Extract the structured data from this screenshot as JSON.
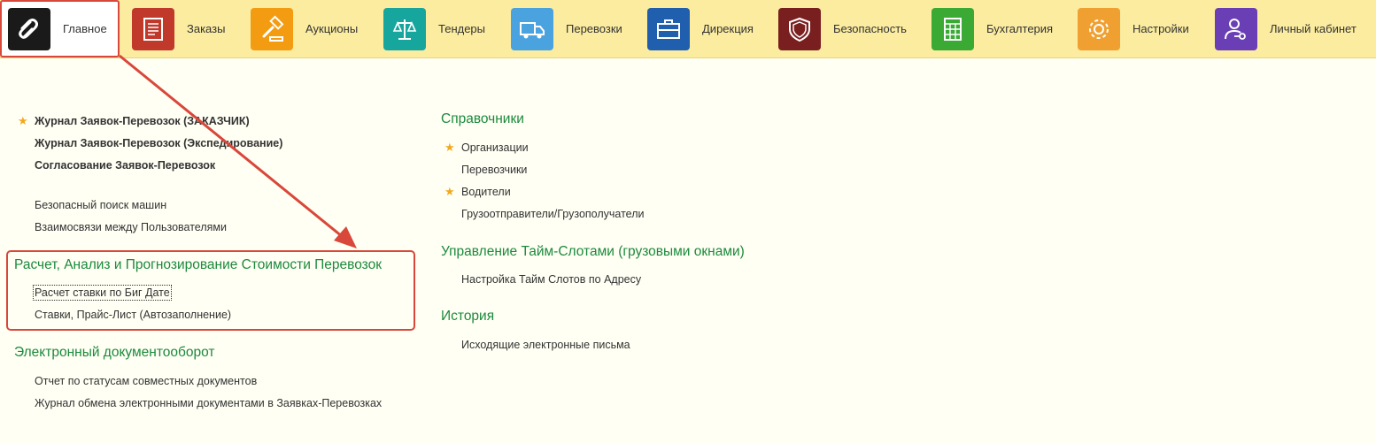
{
  "colors": {
    "accent_red": "#d9473a",
    "link_green": "#1b8a3c",
    "topbar": "#fbeca0",
    "background": "#fffff4",
    "star": "#f2a91f"
  },
  "nav": [
    {
      "id": "main",
      "label": "Главное",
      "icon": "logo-icon",
      "color": "#1a1a1a",
      "active": true
    },
    {
      "id": "orders",
      "label": "Заказы",
      "icon": "notebook-icon",
      "color": "#c0392b"
    },
    {
      "id": "auctions",
      "label": "Аукционы",
      "icon": "gavel-icon",
      "color": "#f39c12"
    },
    {
      "id": "tenders",
      "label": "Тендеры",
      "icon": "scales-icon",
      "color": "#16a69e"
    },
    {
      "id": "transport",
      "label": "Перевозки",
      "icon": "truck-icon",
      "color": "#4aa3df"
    },
    {
      "id": "direction",
      "label": "Дирекция",
      "icon": "briefcase-icon",
      "color": "#1f5fae"
    },
    {
      "id": "security",
      "label": "Безопасность",
      "icon": "shield-icon",
      "color": "#7a1f1f"
    },
    {
      "id": "accounting",
      "label": "Бухгалтерия",
      "icon": "calculator-icon",
      "color": "#3aaa35"
    },
    {
      "id": "settings",
      "label": "Настройки",
      "icon": "gear-icon",
      "color": "#f0a030"
    },
    {
      "id": "cabinet",
      "label": "Личный кабинет",
      "icon": "user-key-icon",
      "color": "#6a3fb5"
    }
  ],
  "left": {
    "top_links": [
      {
        "label": "Журнал Заявок-Перевозок (ЗАКАЗЧИК)",
        "starred": true
      },
      {
        "label": "Журнал Заявок-Перевозок (Экспедирование)"
      },
      {
        "label": "Согласование Заявок-Перевозок"
      }
    ],
    "misc_links": [
      {
        "label": "Безопасный поиск машин"
      },
      {
        "label": "Взаимосвязи между Пользователями"
      }
    ],
    "sections": [
      {
        "title": "Расчет, Анализ и Прогнозирование Стоимости Перевозок",
        "links": [
          {
            "label": "Расчет ставки по Биг Дате"
          },
          {
            "label": "Ставки, Прайс-Лист (Автозаполнение)"
          }
        ]
      },
      {
        "title": "Электронный документооборот",
        "links": [
          {
            "label": "Отчет по статусам совместных документов"
          },
          {
            "label": "Журнал обмена электронными документами в Заявках-Перевозках"
          }
        ]
      }
    ]
  },
  "right": {
    "sections": [
      {
        "title": "Справочники",
        "links": [
          {
            "label": "Организации",
            "starred": true
          },
          {
            "label": "Перевозчики"
          },
          {
            "label": "Водители",
            "starred": true
          },
          {
            "label": "Грузоотправители/Грузополучатели"
          }
        ]
      },
      {
        "title": "Управление Тайм-Слотами (грузовыми окнами)",
        "links": [
          {
            "label": "Настройка Тайм Слотов по Адресу"
          }
        ]
      },
      {
        "title": "История",
        "links": [
          {
            "label": "Исходящие электронные письма"
          }
        ]
      }
    ]
  }
}
